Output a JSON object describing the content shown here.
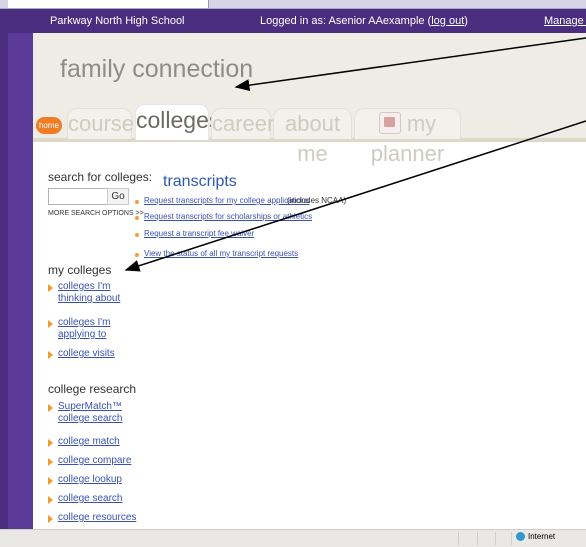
{
  "topbar": {
    "school": "Parkway North High School",
    "logged": "Logged in as: Asenior AAexample (",
    "logout": "log out",
    "logged_close": ")",
    "manage": "Manage my a"
  },
  "header": {
    "brand": "family connection",
    "home": "home"
  },
  "tabs": [
    {
      "label": "courses"
    },
    {
      "label": "colleges"
    },
    {
      "label": "careers"
    },
    {
      "label": "about me"
    },
    {
      "label": "my planner"
    }
  ],
  "sidebar": {
    "search_label": "search for colleges:",
    "go": "Go",
    "more": "MORE SEARCH OPTIONS >>",
    "my_colleges": "my colleges",
    "my_links": [
      "colleges I'm thinking about",
      "colleges I'm applying to",
      "college visits"
    ],
    "research": "college research",
    "research_links": [
      "SuperMatch™ college search",
      "college match",
      "college compare",
      "college lookup",
      "college search",
      "college resources"
    ]
  },
  "content": {
    "title": "transcripts",
    "items": [
      {
        "link": "Request transcripts for my college applications",
        "note": " (includes NCAA)"
      },
      {
        "link": "Request transcripts for scholarships or athletics",
        "note": ""
      },
      {
        "link": "Request a transcript fee waiver",
        "note": ""
      },
      {
        "link": "View the status of all my transcript requests",
        "note": ""
      }
    ]
  },
  "status": {
    "zone": "Internet"
  }
}
